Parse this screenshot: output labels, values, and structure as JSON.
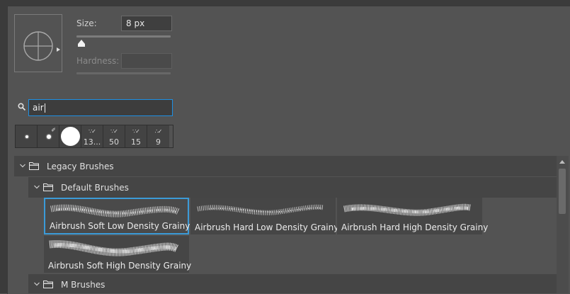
{
  "size": {
    "label": "Size:",
    "value": "8 px",
    "slider_fraction": 0.03
  },
  "hardness": {
    "label": "Hardness:",
    "value": ""
  },
  "search": {
    "value": "air"
  },
  "recent_brushes": [
    {
      "icon": "soft-round-small-brush",
      "number": ""
    },
    {
      "icon": "soft-round-brush",
      "number": ""
    },
    {
      "icon": "hard-round-large-brush",
      "number": ""
    },
    {
      "icon": "spray-brush",
      "number": "13..."
    },
    {
      "icon": "spray-brush",
      "number": "50"
    },
    {
      "icon": "spray-brush",
      "number": "15"
    },
    {
      "icon": "spray-brush",
      "number": "9"
    }
  ],
  "groups": {
    "legacy": "Legacy Brushes",
    "default": "Default Brushes",
    "m": "M Brushes"
  },
  "brushes": [
    {
      "label": "Airbrush Soft Low Density Grainy",
      "selected": true
    },
    {
      "label": "Airbrush Hard Low Density Grainy",
      "selected": false
    },
    {
      "label": "Airbrush Hard High Density Grainy",
      "selected": false
    },
    {
      "label": "Airbrush Soft High Density Grainy",
      "selected": false
    }
  ],
  "colors": {
    "accent": "#3b9bd8",
    "search_border": "#1e8fe3",
    "panel": "#535353"
  }
}
